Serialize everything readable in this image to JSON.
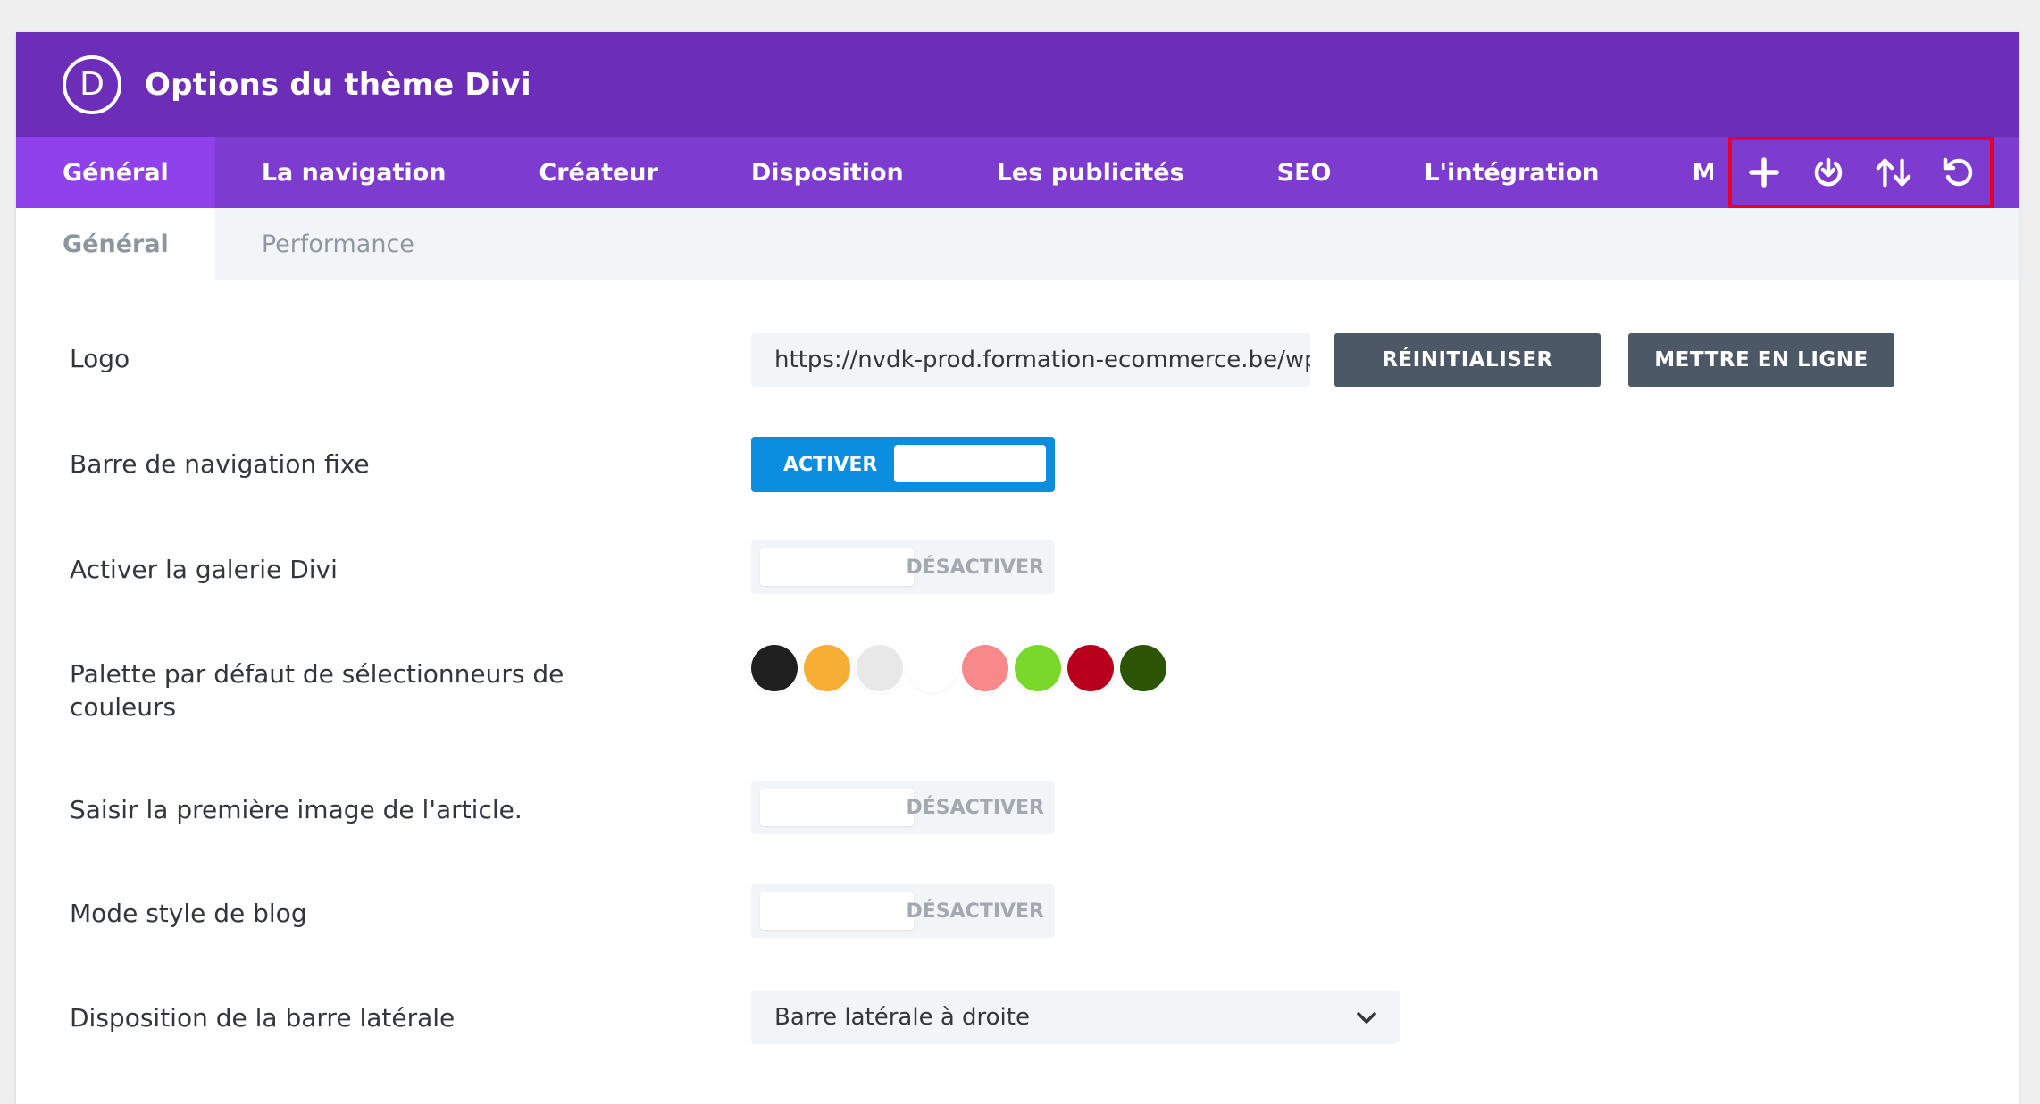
{
  "header": {
    "logo_letter": "D",
    "title": "Options du thème Divi"
  },
  "main_tabs": [
    {
      "label": "Général",
      "active": true
    },
    {
      "label": "La navigation",
      "active": false
    },
    {
      "label": "Créateur",
      "active": false
    },
    {
      "label": "Disposition",
      "active": false
    },
    {
      "label": "Les publicités",
      "active": false
    },
    {
      "label": "SEO",
      "active": false
    },
    {
      "label": "L'intégration",
      "active": false
    },
    {
      "label": "Mises à jour",
      "active": false
    }
  ],
  "actions": {
    "icons": [
      "plus-icon",
      "power-download-icon",
      "import-export-arrows-icon",
      "reset-undo-icon"
    ]
  },
  "sub_tabs": [
    {
      "label": "Général",
      "active": true
    },
    {
      "label": "Performance",
      "active": false
    }
  ],
  "settings": {
    "logo": {
      "label": "Logo",
      "value": "https://nvdk-prod.formation-ecommerce.be/wp-content",
      "reset_label": "RÉINITIALISER",
      "upload_label": "METTRE EN LIGNE"
    },
    "fixed_nav": {
      "label": "Barre de navigation fixe",
      "state": "ACTIVER"
    },
    "divi_gallery": {
      "label": "Activer la galerie Divi",
      "state": "DÉSACTIVER"
    },
    "palette": {
      "label": "Palette par défaut de sélectionneurs de couleurs",
      "colors": [
        "#1f1f1f",
        "#f7ae35",
        "#e8e8e8",
        "#ffffff",
        "#f7898a",
        "#7ad82a",
        "#b8001c",
        "#2b5404"
      ]
    },
    "first_image": {
      "label": "Saisir la première image de l'article.",
      "state": "DÉSACTIVER"
    },
    "blog_style": {
      "label": "Mode style de blog",
      "state": "DÉSACTIVER"
    },
    "sidebar_layout": {
      "label": "Disposition de la barre latérale",
      "value": "Barre latérale à droite"
    }
  },
  "colors": {
    "header_bg": "#6c2eb9",
    "nav_bg": "#7e3bd0",
    "active_tab_bg": "#8f42ec",
    "toggle_on": "#0c8ee0",
    "highlight_border": "#e5002b",
    "dark_button": "#4c5866"
  }
}
